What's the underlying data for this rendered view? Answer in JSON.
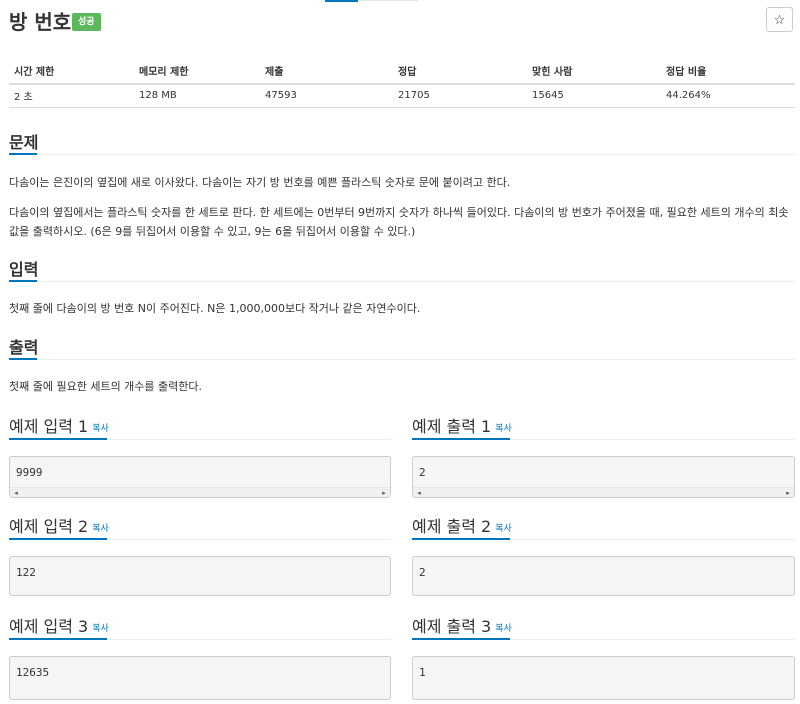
{
  "problem": {
    "title": "방 번호",
    "badge": "성공",
    "star": "☆"
  },
  "info_table": {
    "headers": [
      "시간 제한",
      "메모리 제한",
      "제출",
      "정답",
      "맞힌 사람",
      "정답 비율"
    ],
    "values": [
      "2 초",
      "128 MB",
      "47593",
      "21705",
      "15645",
      "44.264%"
    ]
  },
  "sections": {
    "problem_title": "문제",
    "problem_p1": "다솜이는 은진이의 옆집에 새로 이사왔다. 다솜이는 자기 방 번호를 예쁜 플라스틱 숫자로 문에 붙이려고 한다.",
    "problem_p2": "다솜이의 옆집에서는 플라스틱 숫자를 한 세트로 판다. 한 세트에는 0번부터 9번까지 숫자가 하나씩 들어있다. 다솜이의 방 번호가 주어졌을 때, 필요한 세트의 개수의 최솟값을 출력하시오. (6은 9를 뒤집어서 이용할 수 있고, 9는 6을 뒤집어서 이용할 수 있다.)",
    "input_title": "입력",
    "input_p": "첫째 줄에 다솜이의 방 번호 N이 주어진다. N은 1,000,000보다 작거나 같은 자연수이다.",
    "output_title": "출력",
    "output_p": "첫째 줄에 필요한 세트의 개수를 출력한다."
  },
  "examples": [
    {
      "input_label": "예제 입력 1",
      "output_label": "예제 출력 1",
      "input": "9999",
      "output": "2"
    },
    {
      "input_label": "예제 입력 2",
      "output_label": "예제 출력 2",
      "input": "122",
      "output": "2"
    },
    {
      "input_label": "예제 입력 3",
      "output_label": "예제 출력 3",
      "input": "12635",
      "output": "1"
    }
  ],
  "copy_label": "복사",
  "scroll": {
    "left": "◂",
    "right": "▸"
  },
  "colors": {
    "accent": "#0076c0",
    "success": "#5cb85c"
  }
}
